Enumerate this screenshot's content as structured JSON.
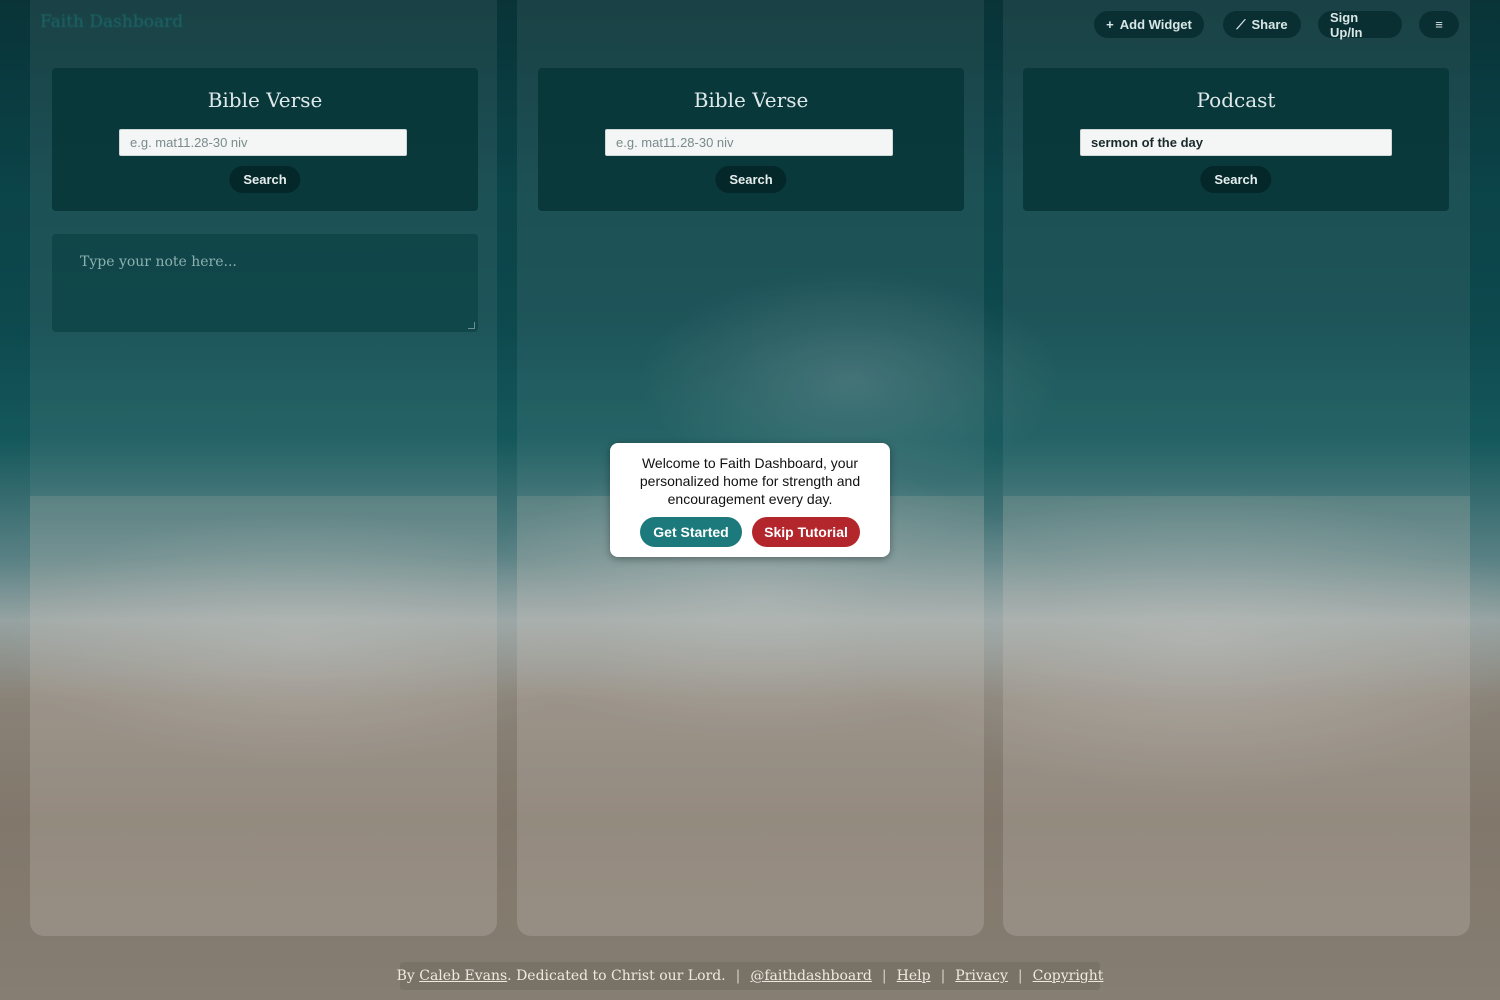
{
  "app": {
    "title": "Faith Dashboard"
  },
  "header": {
    "add_widget": "Add Widget",
    "share": "Share",
    "sign": "Sign Up/In",
    "menu_icon": "hamburger-menu-icon"
  },
  "widgets": [
    {
      "title": "Bible Verse",
      "placeholder": "e.g. mat11.28-30 niv",
      "value": "",
      "button": "Search"
    },
    {
      "title": "Bible Verse",
      "placeholder": "e.g. mat11.28-30 niv",
      "value": "",
      "button": "Search"
    },
    {
      "title": "Podcast",
      "placeholder": "",
      "value": "sermon of the day",
      "button": "Search"
    }
  ],
  "note": {
    "placeholder": "Type your note here..."
  },
  "modal": {
    "message": "Welcome to Faith Dashboard, your personalized home for strength and encouragement every day.",
    "get_started": "Get Started",
    "skip": "Skip Tutorial",
    "colors": {
      "get_started": "#1d7a7c",
      "skip": "#b3262c"
    }
  },
  "footer": {
    "by": "By",
    "author": "Caleb Evans",
    "dedication": ". Dedicated to Christ our Lord.",
    "handle": "@faithdashboard",
    "help": "Help",
    "privacy": "Privacy",
    "copyright": "Copyright"
  }
}
